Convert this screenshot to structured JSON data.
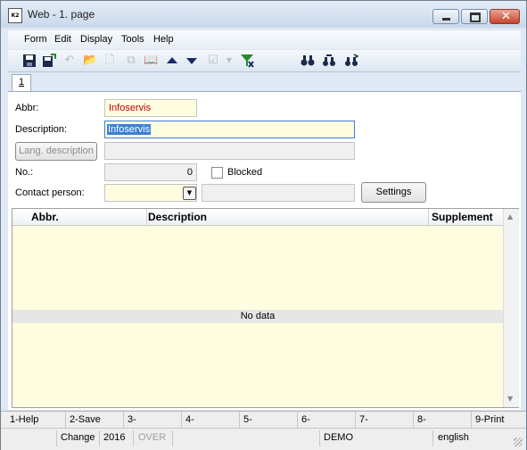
{
  "window": {
    "title": "Web - 1. page",
    "icon_text": "K2"
  },
  "menu": [
    "Form",
    "Edit",
    "Display",
    "Tools",
    "Help"
  ],
  "toolbar_icons": [
    "save-icon",
    "save-as-icon",
    "undo-icon",
    "open-folder-icon",
    "new-document-icon",
    "copy-icon",
    "book-icon",
    "arrow-up-icon",
    "arrow-down-icon",
    "checkmark-icon",
    "dropdown-arrow-icon",
    "filter-icon",
    "binoculars-icon",
    "binoculars-next-icon",
    "binoculars-prev-icon"
  ],
  "tab": {
    "label": "1"
  },
  "form": {
    "abbr_label": "Abbr:",
    "abbr_value": "Infoservis",
    "description_label": "Description:",
    "description_value": "Infoservis",
    "lang_description_button": "Lang. description",
    "lang_description_value": "",
    "no_label": "No.:",
    "no_value": "0",
    "blocked_label": "Blocked",
    "blocked_checked": false,
    "contact_person_label": "Contact person:",
    "contact_person_value": "",
    "contact_person_name": "",
    "settings_button": "Settings"
  },
  "grid": {
    "columns": [
      "Abbr.",
      "Description",
      "Supplement"
    ],
    "rows": [],
    "empty_text": "No data"
  },
  "fkeys": [
    "1-Help",
    "2-Save",
    "3-",
    "4-",
    "5-",
    "6-",
    "7-",
    "8-",
    "9-Print"
  ],
  "status": {
    "mode": "Change",
    "year": "2016",
    "overwrite": "OVER",
    "database": "DEMO",
    "language": "english"
  },
  "colors": {
    "accent": "#3c7fd6",
    "field_yellow": "#fffde0",
    "abbr_text": "#c00000"
  }
}
